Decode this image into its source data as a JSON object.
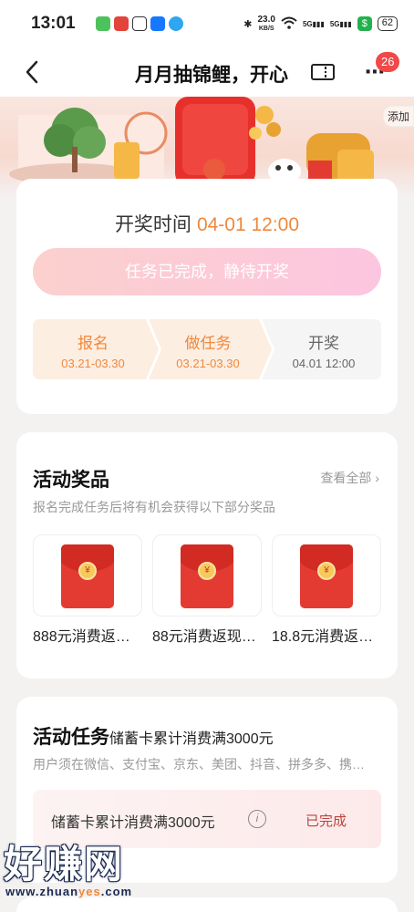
{
  "status_bar": {
    "time": "13:01",
    "net_speed": "23.0",
    "net_unit": "KB/S",
    "signal1": "5G",
    "signal2": "5G",
    "battery": "62"
  },
  "nav": {
    "title": "月月抽锦鲤，开心",
    "badge_count": "26"
  },
  "banner": {
    "add_label": "添加"
  },
  "draw": {
    "label": "开奖时间",
    "time": "04-01 12:00",
    "status_button": "任务已完成，静待开奖",
    "steps": [
      {
        "label": "报名",
        "date": "03.21-03.30"
      },
      {
        "label": "做任务",
        "date": "03.21-03.30"
      },
      {
        "label": "开奖",
        "date": "04.01 12:00"
      }
    ]
  },
  "prizes": {
    "title": "活动奖品",
    "view_all": "查看全部",
    "subtitle": "报名完成任务后将有机会获得以下部分奖品",
    "items": [
      {
        "name": "888元消费返…"
      },
      {
        "name": "88元消费返现…"
      },
      {
        "name": "18.8元消费返…"
      }
    ]
  },
  "tasks": {
    "title": "活动任务",
    "title_detail": "储蓄卡累计消费满3000元",
    "subtitle": "用户须在微信、支付宝、京东、美团、抖音、拼多多、携…",
    "item_text": "储蓄卡累计消费满3000元",
    "item_status": "已完成"
  },
  "watermark": {
    "text": "好赚网",
    "url_pre": "www.zhuan",
    "url_hl": "yes",
    "url_post": ".com"
  },
  "colors": {
    "accent": "#f0883c",
    "badge": "#f14848",
    "envelope": "#e33b32"
  }
}
